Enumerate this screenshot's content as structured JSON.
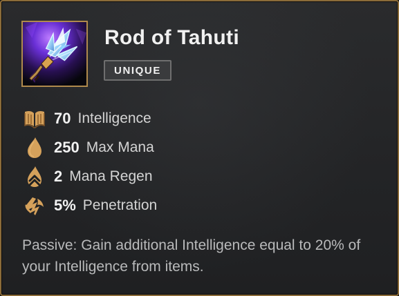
{
  "item": {
    "name": "Rod of Tahuti",
    "rarity": "UNIQUE",
    "icon": "crystal-staff-icon"
  },
  "stats": [
    {
      "value": "70",
      "label": "Intelligence",
      "icon": "book-icon"
    },
    {
      "value": "250",
      "label": "Max Mana",
      "icon": "mana-drop-icon"
    },
    {
      "value": "2",
      "label": "Mana Regen",
      "icon": "mana-regen-icon"
    },
    {
      "value": "5%",
      "label": "Penetration",
      "icon": "penetration-icon"
    }
  ],
  "passive": {
    "text": "Passive: Gain additional Intelligence equal to 20% of your Intelligence from items."
  },
  "colors": {
    "frame_gold": "#8b6b39",
    "stat_icon_gold": "#d5a15b",
    "background": "#252628",
    "title": "#f1f1f1",
    "label": "#d4d4d4",
    "passive": "#b9babb"
  }
}
